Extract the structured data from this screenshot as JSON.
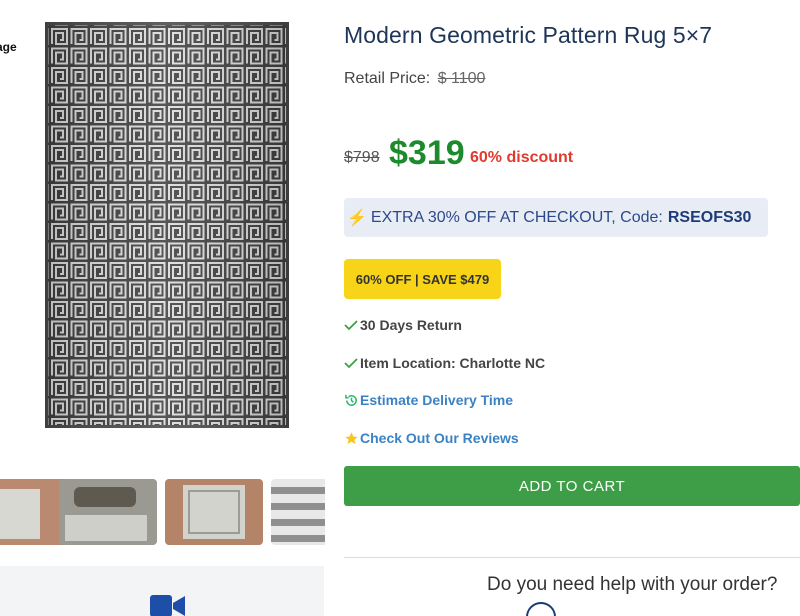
{
  "gallery": {
    "cut_label": "age",
    "main_image_icon": "rug-image",
    "thumbnails": [
      {
        "icon": "rug-thumbnail-floor"
      },
      {
        "icon": "rug-thumbnail-living-room"
      },
      {
        "icon": "rug-thumbnail-wood-floor"
      },
      {
        "icon": "rug-thumbnail-stripes"
      }
    ],
    "video_icon": "video-camera-icon"
  },
  "product": {
    "title": "Modern Geometric Pattern Rug 5×7",
    "retail_label": "Retail Price:",
    "retail_value": "$ 1100",
    "old_price": "$798",
    "sale_price": "$319",
    "discount_text": "60% discount"
  },
  "promo": {
    "icon": "lightning-bolt",
    "text": "EXTRA 30% OFF AT CHECKOUT, Code:",
    "code": "RSEOFS30"
  },
  "badge": {
    "text": "60% OFF | SAVE $479"
  },
  "features": [
    {
      "icon": "check-icon",
      "text": "30 Days Return"
    },
    {
      "icon": "check-icon",
      "text": "Item Location: Charlotte NC"
    },
    {
      "icon": "clock-history-icon",
      "text": "Estimate Delivery Time"
    },
    {
      "icon": "star-icon",
      "text": "Check Out Our Reviews"
    }
  ],
  "cart": {
    "label": "ADD TO CART"
  },
  "help": {
    "title": "Do you need help with your order?"
  },
  "colors": {
    "title": "#1d3557",
    "sale_price": "#1d8a2d",
    "discount": "#e03a2f",
    "promo_bg": "#e8edf5",
    "badge_bg": "#f7d417",
    "cart_bg": "#3e9e47",
    "link": "#3b82c4"
  }
}
